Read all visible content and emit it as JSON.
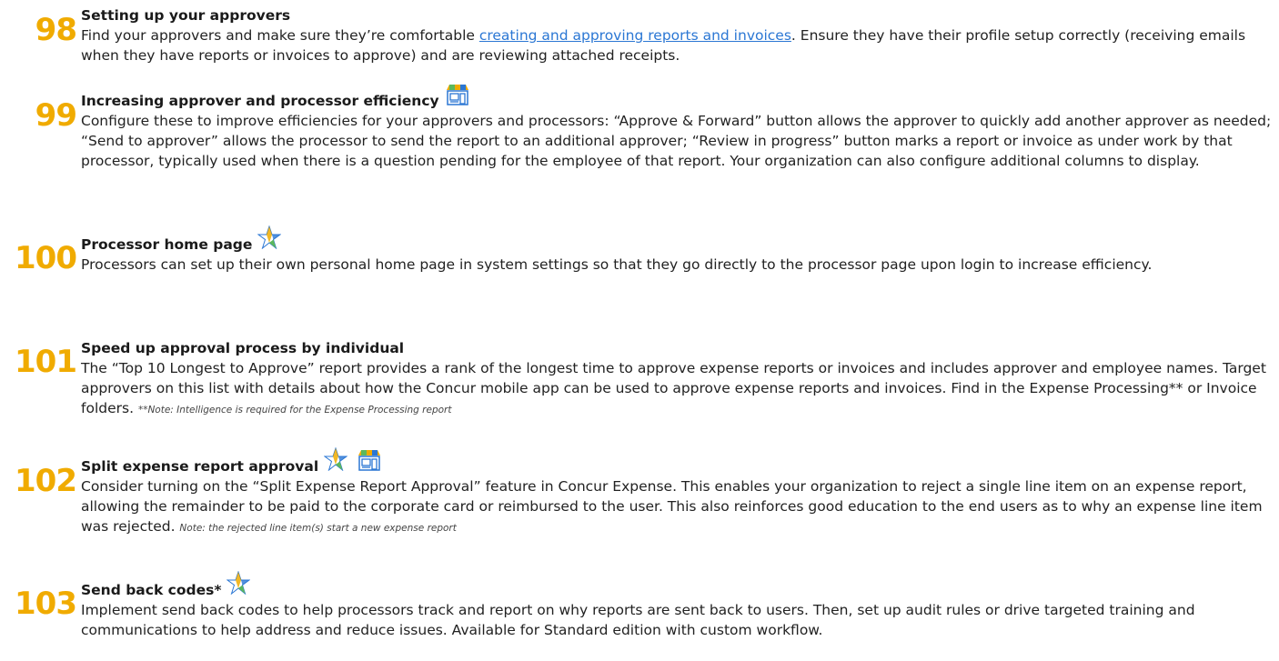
{
  "tips": [
    {
      "number": "98",
      "title": "Setting up your approvers",
      "body_before_link": "Find your approvers and make sure they’re comfortable ",
      "link_text": "creating and approving reports and invoices",
      "body_after_link": ". Ensure they have their profile setup correctly (receiving emails when they have reports or invoices to approve) and are reviewing attached receipts."
    },
    {
      "number": "99",
      "title": "Increasing approver and processor efficiency",
      "icons": [
        "storefront-icon"
      ],
      "body": "Configure these to improve efficiencies for your approvers and processors: “Approve & Forward” button allows the approver to quickly add another approver as needed; “Send to approver” allows the processor to send the report to an additional approver; “Review in progress” button marks a report or invoice as under work by that processor, typically used when there is a question pending for the employee of that report. Your organization can also configure additional columns to display."
    },
    {
      "number": "100",
      "title": "Processor home page",
      "icons": [
        "star-icon"
      ],
      "body": "Processors can set up their own personal home page in system settings so that they go directly to the processor page upon login to increase efficiency."
    },
    {
      "number": "101",
      "title": "Speed up approval process by individual",
      "body": "The “Top 10 Longest to Approve” report provides a rank of the longest time to approve expense reports or invoices and includes approver and employee names. Target approvers on this list with details about how the Concur mobile app can be used to approve expense reports and invoices. Find in the Expense Processing** or Invoice folders. ",
      "note": "**Note: Intelligence is required for the Expense Processing report"
    },
    {
      "number": "102",
      "title": "Split expense report approval",
      "icons": [
        "star-icon",
        "storefront-icon"
      ],
      "body": "Consider turning on the “Split Expense Report Approval” feature in Concur Expense. This enables your organization to reject a single line item on an expense report, allowing the remainder to be paid to the corporate card or reimbursed to the user. This also reinforces good education to the end users as to why an expense line item was rejected. ",
      "note": "Note: the rejected line item(s) start a new expense report"
    },
    {
      "number": "103",
      "title": "Send back codes*",
      "icons": [
        "star-icon"
      ],
      "body": "Implement send back codes to help processors track and report on why reports are sent back to users. Then, set up audit rules or drive targeted training and communications to help address and reduce issues. Available for Standard edition with custom workflow."
    }
  ],
  "colors": {
    "number": "#f0ab00",
    "link": "#2b77d4",
    "text": "#222222"
  }
}
